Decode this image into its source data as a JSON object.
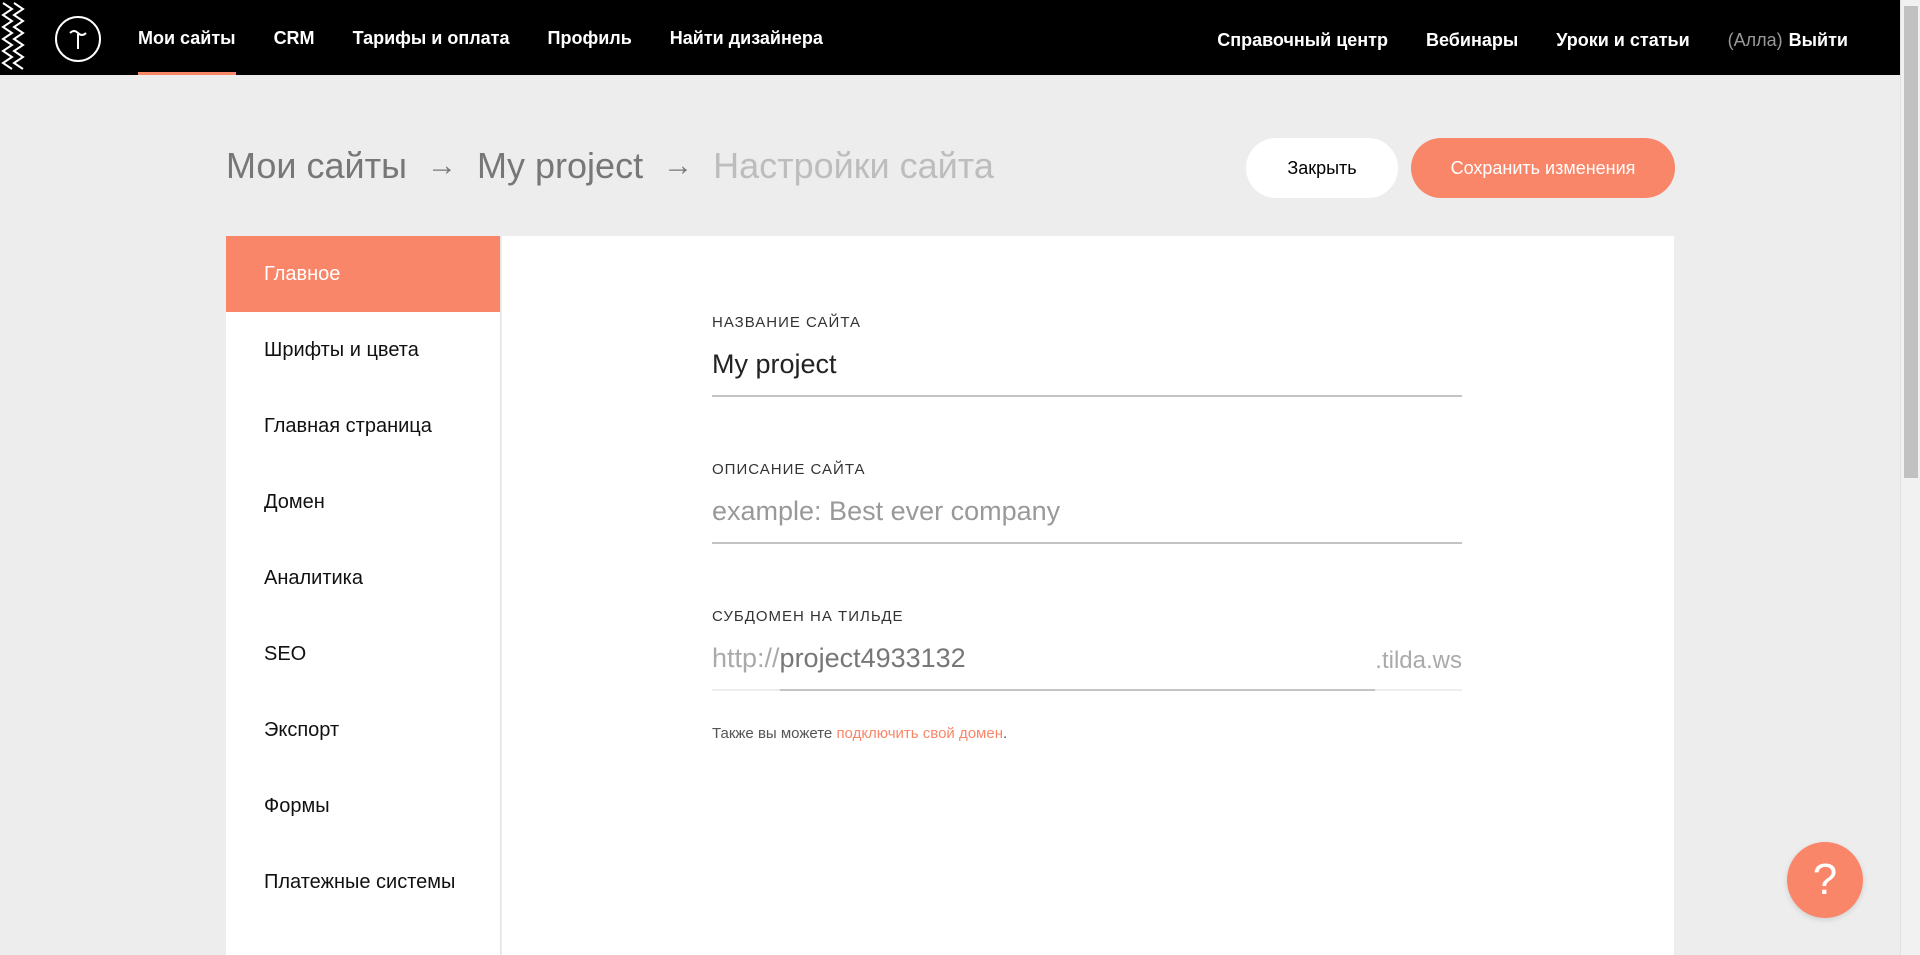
{
  "nav": {
    "left": [
      {
        "label": "Мои сайты",
        "active": true
      },
      {
        "label": "CRM"
      },
      {
        "label": "Тарифы и оплата"
      },
      {
        "label": "Профиль"
      },
      {
        "label": "Найти дизайнера"
      }
    ],
    "right": [
      {
        "label": "Справочный центр"
      },
      {
        "label": "Вебинары"
      },
      {
        "label": "Уроки и статьи"
      }
    ],
    "user_name": "(Алла)",
    "logout_label": "Выйти"
  },
  "breadcrumb": {
    "root": "Мои сайты",
    "project": "My project",
    "current": "Настройки сайта",
    "arrow": "→"
  },
  "actions": {
    "close_label": "Закрыть",
    "save_label": "Сохранить изменения"
  },
  "sidebar": {
    "items": [
      {
        "label": "Главное",
        "active": true
      },
      {
        "label": "Шрифты и цвета"
      },
      {
        "label": "Главная страница"
      },
      {
        "label": "Домен"
      },
      {
        "label": "Аналитика"
      },
      {
        "label": "SEO"
      },
      {
        "label": "Экспорт"
      },
      {
        "label": "Формы"
      },
      {
        "label": "Платежные системы"
      }
    ]
  },
  "form": {
    "site_name": {
      "label": "НАЗВАНИЕ САЙТА",
      "value": "My project"
    },
    "site_description": {
      "label": "ОПИСАНИЕ САЙТА",
      "placeholder": "example: Best ever company"
    },
    "subdomain": {
      "label": "СУБДОМЕН НА ТИЛЬДЕ",
      "prefix": "http://",
      "value": "project4933132",
      "suffix": ".tilda.ws"
    },
    "hint_text": "Также вы можете ",
    "hint_link": "подключить свой домен",
    "hint_end": "."
  },
  "help": {
    "symbol": "?"
  },
  "colors": {
    "accent": "#fa8669",
    "topbar": "#000000",
    "background": "#ededed"
  }
}
